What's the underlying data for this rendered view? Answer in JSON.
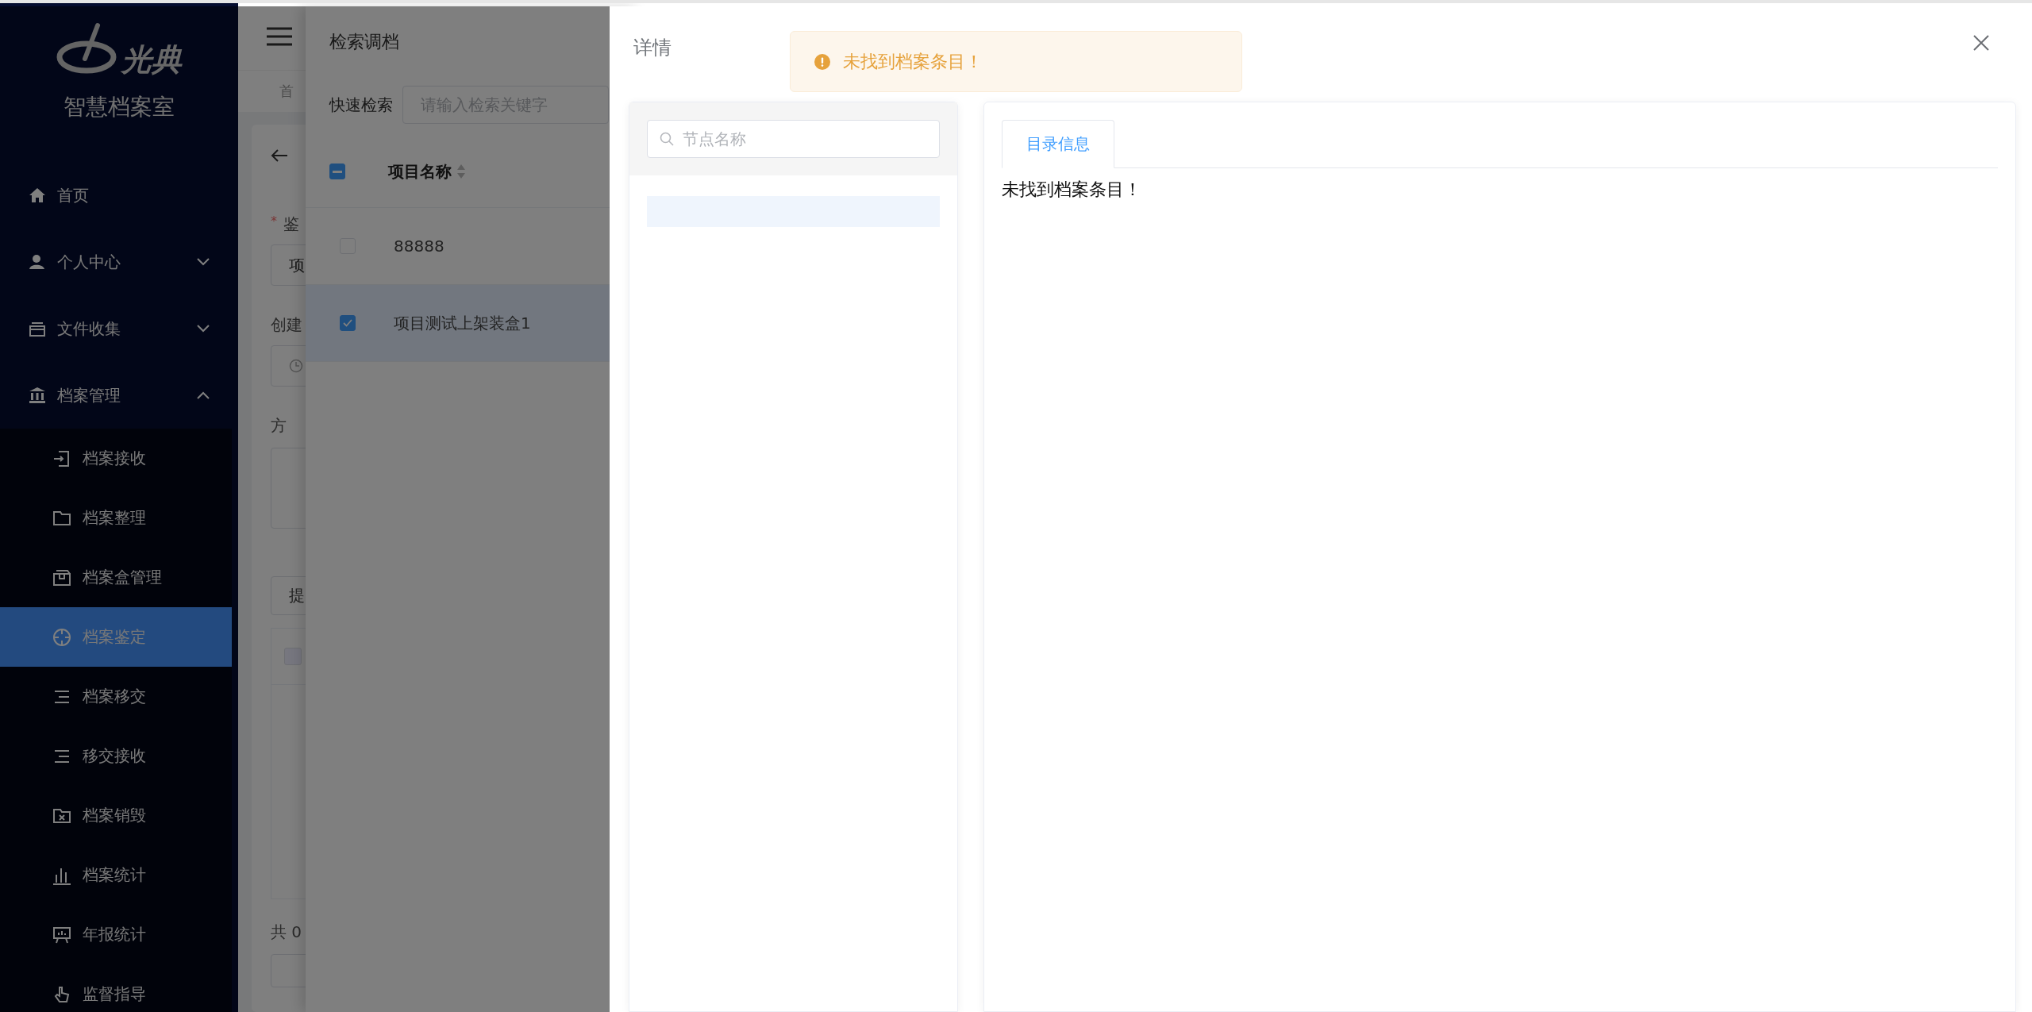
{
  "sidebar": {
    "logo": "光典",
    "title": "智慧档案室",
    "menu": [
      {
        "label": "首页"
      },
      {
        "label": "个人中心",
        "expanded": false
      },
      {
        "label": "文件收集",
        "expanded": false
      },
      {
        "label": "档案管理",
        "expanded": true,
        "children": [
          {
            "label": "档案接收",
            "selected": false
          },
          {
            "label": "档案整理",
            "selected": false
          },
          {
            "label": "档案盒管理",
            "selected": false
          },
          {
            "label": "档案鉴定",
            "selected": true
          },
          {
            "label": "档案移交",
            "selected": false
          },
          {
            "label": "移交接收",
            "selected": false
          },
          {
            "label": "档案销毁",
            "selected": false
          },
          {
            "label": "档案统计",
            "selected": false
          },
          {
            "label": "年报统计",
            "selected": false
          },
          {
            "label": "监督指导",
            "selected": false
          }
        ]
      }
    ]
  },
  "page": {
    "tab": "首",
    "required_mark": "*",
    "required_label": "鉴",
    "field_value": "项",
    "date_label": "创建",
    "plan_label": "方",
    "button": "提",
    "table_checked": false,
    "total": "共 0"
  },
  "search_dialog": {
    "title": "检索调档",
    "search_label": "快速检索",
    "search_placeholder": "请输入检索关键字",
    "header_indeterminate": true,
    "columns": [
      {
        "label": "项目名称",
        "sortable": true
      }
    ],
    "rows": [
      {
        "name": "88888",
        "checked": false
      },
      {
        "name": "项目测试上架装盒1",
        "checked": true
      }
    ]
  },
  "detail_drawer": {
    "title": "详情",
    "alert": {
      "kind": "warning",
      "text": "未找到档案条目！"
    },
    "tree_search_placeholder": "节点名称",
    "tree_nodes": [
      {
        "selected": true
      }
    ],
    "tabs": [
      {
        "label": "目录信息",
        "selected": true
      }
    ],
    "content": "未找到档案条目！"
  }
}
